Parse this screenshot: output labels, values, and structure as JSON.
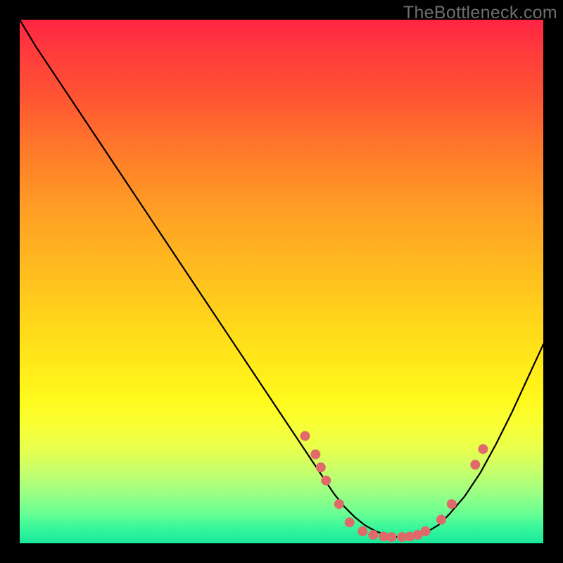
{
  "watermark": "TheBottleneck.com",
  "colors": {
    "background": "#000000",
    "curve": "#000000",
    "marker": "#e06a6a",
    "gradient_top": "#ff2445",
    "gradient_bottom": "#18e89a"
  },
  "chart_data": {
    "type": "line",
    "title": "",
    "xlabel": "",
    "ylabel": "",
    "xlim": [
      0,
      100
    ],
    "ylim": [
      0,
      100
    ],
    "grid": false,
    "legend": false,
    "x": [
      0,
      3,
      7,
      12,
      18,
      24,
      30,
      36,
      42,
      47,
      51,
      55,
      58,
      60,
      62,
      64,
      66,
      68,
      70,
      72,
      74,
      76,
      78,
      80,
      82,
      85,
      88,
      91,
      94,
      97,
      100
    ],
    "values": [
      100,
      95,
      89,
      81.5,
      72.5,
      63.5,
      54.5,
      45.5,
      36.5,
      29,
      23,
      17,
      12.5,
      9.5,
      7,
      5,
      3.4,
      2.3,
      1.6,
      1.2,
      1.2,
      1.6,
      2.3,
      3.5,
      5.5,
      9,
      13.5,
      19,
      25,
      31.5,
      38
    ],
    "markers": [
      {
        "x": 54.5,
        "y": 20.5
      },
      {
        "x": 56.5,
        "y": 17.0
      },
      {
        "x": 57.5,
        "y": 14.5
      },
      {
        "x": 58.5,
        "y": 12.0
      },
      {
        "x": 61.0,
        "y": 7.5
      },
      {
        "x": 63.0,
        "y": 4.0
      },
      {
        "x": 65.5,
        "y": 2.3
      },
      {
        "x": 67.5,
        "y": 1.6
      },
      {
        "x": 69.5,
        "y": 1.3
      },
      {
        "x": 71.0,
        "y": 1.2
      },
      {
        "x": 73.0,
        "y": 1.2
      },
      {
        "x": 74.5,
        "y": 1.3
      },
      {
        "x": 76.0,
        "y": 1.6
      },
      {
        "x": 77.5,
        "y": 2.3
      },
      {
        "x": 80.5,
        "y": 4.5
      },
      {
        "x": 82.5,
        "y": 7.5
      },
      {
        "x": 87.0,
        "y": 15.0
      },
      {
        "x": 88.5,
        "y": 18.0
      }
    ],
    "annotations": []
  }
}
